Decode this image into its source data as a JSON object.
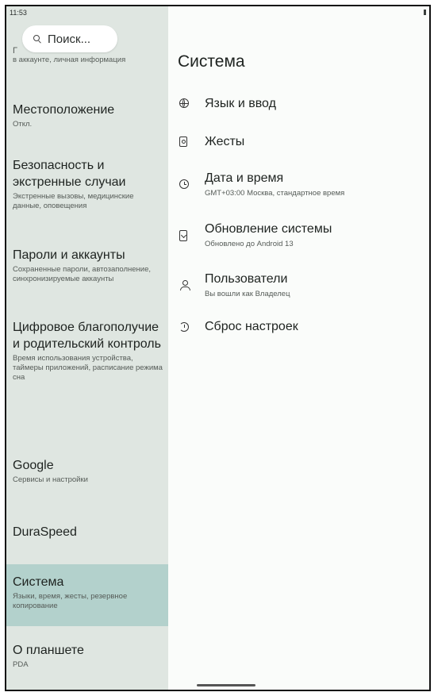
{
  "status_bar": {
    "time": "11:53"
  },
  "search": {
    "label": "Поиск..."
  },
  "sidebar": {
    "partial_item": {
      "title": "Г",
      "subtitle": "в аккаунте, личная информация"
    },
    "items": [
      {
        "title": "Местоположение",
        "subtitle": "Откл."
      },
      {
        "title": "Безопасность и экстренные случаи",
        "subtitle": "Экстренные вызовы, медицинские данные, оповещения"
      },
      {
        "title": "Пароли и аккаунты",
        "subtitle": "Сохраненные пароли, автозаполнение, синхронизируемые аккаунты"
      },
      {
        "title": "Цифровое благополучие и родительский контроль",
        "subtitle": "Время использования устройства, таймеры приложений, расписание режима сна"
      },
      {
        "title": "Google",
        "subtitle": "Сервисы и настройки"
      },
      {
        "title": "DuraSpeed",
        "subtitle": ""
      },
      {
        "title": "Система",
        "subtitle": "Языки, время, жесты, резервное копирование",
        "selected": true
      },
      {
        "title": "О планшете",
        "subtitle": "PDA"
      }
    ]
  },
  "main": {
    "title": "Система",
    "rows": [
      {
        "title": "Язык и ввод",
        "subtitle": "",
        "icon": "globe-icon"
      },
      {
        "title": "Жесты",
        "subtitle": "",
        "icon": "gesture-icon"
      },
      {
        "title": "Дата и время",
        "subtitle": "GMT+03:00 Москва, стандартное время",
        "icon": "clock-icon"
      },
      {
        "title": "Обновление системы",
        "subtitle": "Обновлено до Android 13",
        "icon": "system-update-icon"
      },
      {
        "title": "Пользователи",
        "subtitle": "Вы вошли как Владелец",
        "icon": "users-icon"
      },
      {
        "title": "Сброс настроек",
        "subtitle": "",
        "icon": "reset-icon"
      }
    ]
  },
  "colors": {
    "sidebar_bg": "#dfe6e1",
    "selected_bg": "#b3d1cc",
    "content_bg": "#fafcfa"
  }
}
